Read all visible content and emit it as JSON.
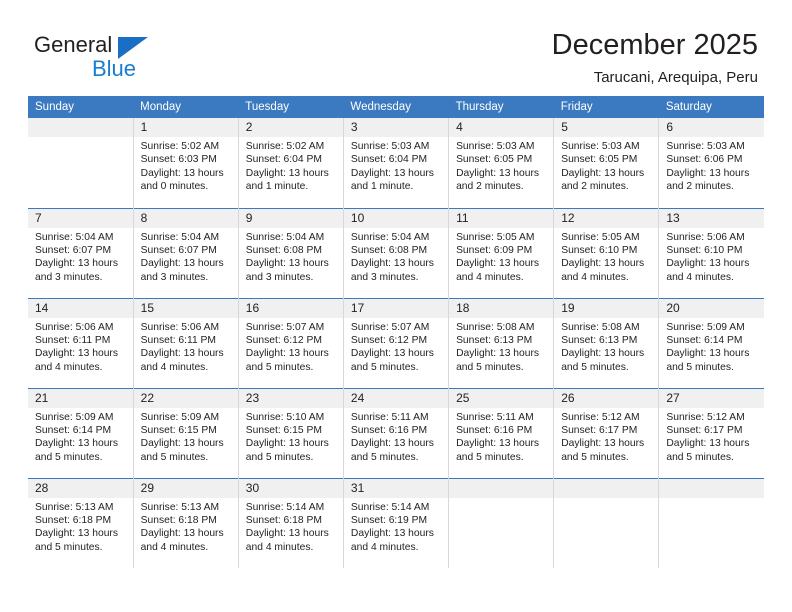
{
  "logo": {
    "part1": "General",
    "part2": "Blue",
    "accent": "#1a7dd1"
  },
  "header": {
    "title": "December 2025",
    "subtitle": "Tarucani, Arequipa, Peru"
  },
  "calendar": {
    "header_bg": "#3b7ac0",
    "daynum_bg": "#f0f0f0",
    "weekdays": [
      "Sunday",
      "Monday",
      "Tuesday",
      "Wednesday",
      "Thursday",
      "Friday",
      "Saturday"
    ],
    "weeks": [
      [
        {
          "day": "",
          "lines": []
        },
        {
          "day": "1",
          "lines": [
            "Sunrise: 5:02 AM",
            "Sunset: 6:03 PM",
            "Daylight: 13 hours",
            "and 0 minutes."
          ]
        },
        {
          "day": "2",
          "lines": [
            "Sunrise: 5:02 AM",
            "Sunset: 6:04 PM",
            "Daylight: 13 hours",
            "and 1 minute."
          ]
        },
        {
          "day": "3",
          "lines": [
            "Sunrise: 5:03 AM",
            "Sunset: 6:04 PM",
            "Daylight: 13 hours",
            "and 1 minute."
          ]
        },
        {
          "day": "4",
          "lines": [
            "Sunrise: 5:03 AM",
            "Sunset: 6:05 PM",
            "Daylight: 13 hours",
            "and 2 minutes."
          ]
        },
        {
          "day": "5",
          "lines": [
            "Sunrise: 5:03 AM",
            "Sunset: 6:05 PM",
            "Daylight: 13 hours",
            "and 2 minutes."
          ]
        },
        {
          "day": "6",
          "lines": [
            "Sunrise: 5:03 AM",
            "Sunset: 6:06 PM",
            "Daylight: 13 hours",
            "and 2 minutes."
          ]
        }
      ],
      [
        {
          "day": "7",
          "lines": [
            "Sunrise: 5:04 AM",
            "Sunset: 6:07 PM",
            "Daylight: 13 hours",
            "and 3 minutes."
          ]
        },
        {
          "day": "8",
          "lines": [
            "Sunrise: 5:04 AM",
            "Sunset: 6:07 PM",
            "Daylight: 13 hours",
            "and 3 minutes."
          ]
        },
        {
          "day": "9",
          "lines": [
            "Sunrise: 5:04 AM",
            "Sunset: 6:08 PM",
            "Daylight: 13 hours",
            "and 3 minutes."
          ]
        },
        {
          "day": "10",
          "lines": [
            "Sunrise: 5:04 AM",
            "Sunset: 6:08 PM",
            "Daylight: 13 hours",
            "and 3 minutes."
          ]
        },
        {
          "day": "11",
          "lines": [
            "Sunrise: 5:05 AM",
            "Sunset: 6:09 PM",
            "Daylight: 13 hours",
            "and 4 minutes."
          ]
        },
        {
          "day": "12",
          "lines": [
            "Sunrise: 5:05 AM",
            "Sunset: 6:10 PM",
            "Daylight: 13 hours",
            "and 4 minutes."
          ]
        },
        {
          "day": "13",
          "lines": [
            "Sunrise: 5:06 AM",
            "Sunset: 6:10 PM",
            "Daylight: 13 hours",
            "and 4 minutes."
          ]
        }
      ],
      [
        {
          "day": "14",
          "lines": [
            "Sunrise: 5:06 AM",
            "Sunset: 6:11 PM",
            "Daylight: 13 hours",
            "and 4 minutes."
          ]
        },
        {
          "day": "15",
          "lines": [
            "Sunrise: 5:06 AM",
            "Sunset: 6:11 PM",
            "Daylight: 13 hours",
            "and 4 minutes."
          ]
        },
        {
          "day": "16",
          "lines": [
            "Sunrise: 5:07 AM",
            "Sunset: 6:12 PM",
            "Daylight: 13 hours",
            "and 5 minutes."
          ]
        },
        {
          "day": "17",
          "lines": [
            "Sunrise: 5:07 AM",
            "Sunset: 6:12 PM",
            "Daylight: 13 hours",
            "and 5 minutes."
          ]
        },
        {
          "day": "18",
          "lines": [
            "Sunrise: 5:08 AM",
            "Sunset: 6:13 PM",
            "Daylight: 13 hours",
            "and 5 minutes."
          ]
        },
        {
          "day": "19",
          "lines": [
            "Sunrise: 5:08 AM",
            "Sunset: 6:13 PM",
            "Daylight: 13 hours",
            "and 5 minutes."
          ]
        },
        {
          "day": "20",
          "lines": [
            "Sunrise: 5:09 AM",
            "Sunset: 6:14 PM",
            "Daylight: 13 hours",
            "and 5 minutes."
          ]
        }
      ],
      [
        {
          "day": "21",
          "lines": [
            "Sunrise: 5:09 AM",
            "Sunset: 6:14 PM",
            "Daylight: 13 hours",
            "and 5 minutes."
          ]
        },
        {
          "day": "22",
          "lines": [
            "Sunrise: 5:09 AM",
            "Sunset: 6:15 PM",
            "Daylight: 13 hours",
            "and 5 minutes."
          ]
        },
        {
          "day": "23",
          "lines": [
            "Sunrise: 5:10 AM",
            "Sunset: 6:15 PM",
            "Daylight: 13 hours",
            "and 5 minutes."
          ]
        },
        {
          "day": "24",
          "lines": [
            "Sunrise: 5:11 AM",
            "Sunset: 6:16 PM",
            "Daylight: 13 hours",
            "and 5 minutes."
          ]
        },
        {
          "day": "25",
          "lines": [
            "Sunrise: 5:11 AM",
            "Sunset: 6:16 PM",
            "Daylight: 13 hours",
            "and 5 minutes."
          ]
        },
        {
          "day": "26",
          "lines": [
            "Sunrise: 5:12 AM",
            "Sunset: 6:17 PM",
            "Daylight: 13 hours",
            "and 5 minutes."
          ]
        },
        {
          "day": "27",
          "lines": [
            "Sunrise: 5:12 AM",
            "Sunset: 6:17 PM",
            "Daylight: 13 hours",
            "and 5 minutes."
          ]
        }
      ],
      [
        {
          "day": "28",
          "lines": [
            "Sunrise: 5:13 AM",
            "Sunset: 6:18 PM",
            "Daylight: 13 hours",
            "and 5 minutes."
          ]
        },
        {
          "day": "29",
          "lines": [
            "Sunrise: 5:13 AM",
            "Sunset: 6:18 PM",
            "Daylight: 13 hours",
            "and 4 minutes."
          ]
        },
        {
          "day": "30",
          "lines": [
            "Sunrise: 5:14 AM",
            "Sunset: 6:18 PM",
            "Daylight: 13 hours",
            "and 4 minutes."
          ]
        },
        {
          "day": "31",
          "lines": [
            "Sunrise: 5:14 AM",
            "Sunset: 6:19 PM",
            "Daylight: 13 hours",
            "and 4 minutes."
          ]
        },
        {
          "day": "",
          "lines": []
        },
        {
          "day": "",
          "lines": []
        },
        {
          "day": "",
          "lines": []
        }
      ]
    ]
  }
}
